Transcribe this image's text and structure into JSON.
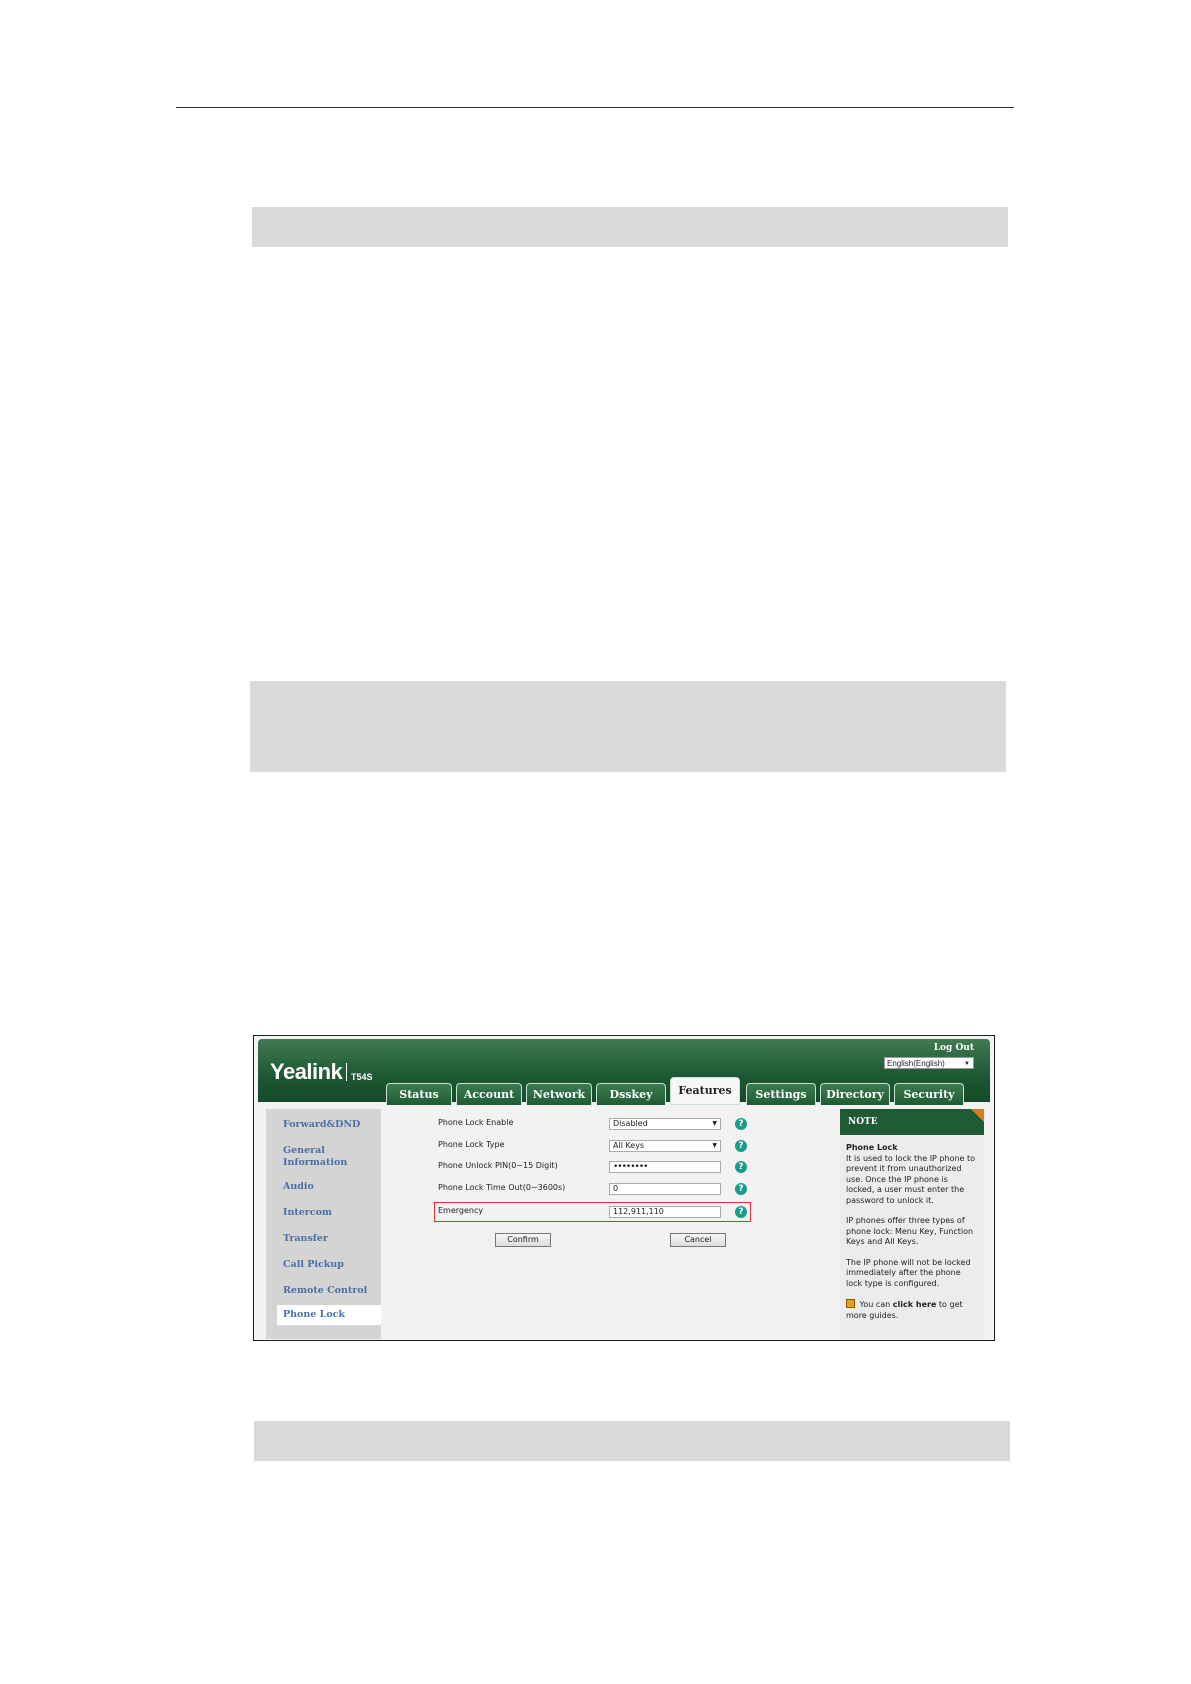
{
  "app": {
    "logo": "Yealink",
    "model": "T54S",
    "logout": "Log Out",
    "language": "English(English)"
  },
  "tabs": [
    "Status",
    "Account",
    "Network",
    "Dsskey",
    "Features",
    "Settings",
    "Directory",
    "Security"
  ],
  "active_tab": "Features",
  "sidebar": [
    "Forward&DND",
    "General Information",
    "Audio",
    "Intercom",
    "Transfer",
    "Call Pickup",
    "Remote Control",
    "Phone Lock"
  ],
  "active_sidebar": "Phone Lock",
  "form": {
    "lock_enable_label": "Phone Lock Enable",
    "lock_enable_value": "Disabled",
    "lock_type_label": "Phone Lock Type",
    "lock_type_value": "All Keys",
    "unlock_pin_label": "Phone Unlock PIN(0~15 Digit)",
    "unlock_pin_value": "••••••••",
    "timeout_label": "Phone Lock Time Out(0~3600s)",
    "timeout_value": "0",
    "emergency_label": "Emergency",
    "emergency_value": "112,911,110",
    "confirm": "Confirm",
    "cancel": "Cancel",
    "help_glyph": "?"
  },
  "note": {
    "header": "NOTE",
    "title": "Phone Lock",
    "p1": "It is used to lock the IP phone to prevent it from unauthorized use. Once the IP phone is locked, a user must enter the password to unlock it.",
    "p2": "IP phones offer three types of phone lock: Menu Key, Function Keys and All Keys.",
    "p3": "The IP phone will not be locked immediately after the phone lock type is configured.",
    "guide_pre": "You can",
    "guide_link": "click here",
    "guide_post": "to get more guides."
  },
  "colors": {
    "header_green": "#1e5a33",
    "sidebar_link": "#4a6fa5",
    "highlight_red": "#dd3333",
    "help_teal": "#1a9c8a",
    "note_corner": "#e07a1f",
    "gray_bar": "#d9d9d9"
  }
}
